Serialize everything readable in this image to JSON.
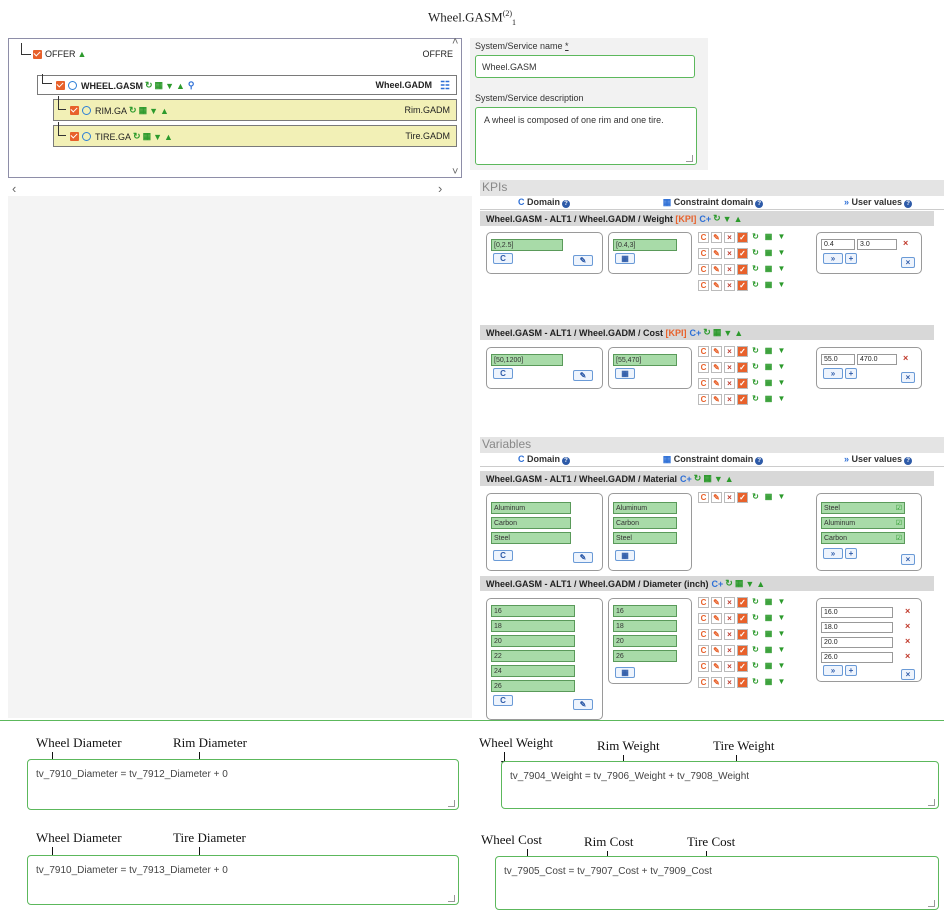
{
  "figure_title": {
    "main": "Wheel.GASM",
    "sup": "(2)",
    "sub": "1"
  },
  "tree": {
    "root": {
      "label": "OFFER",
      "right": "OFFRE"
    },
    "selected": {
      "label": "WHEEL.GASM",
      "right": "Wheel.GADM"
    },
    "children": [
      {
        "label": "RIM.GA",
        "right": "Rim.GADM"
      },
      {
        "label": "TIRE.GA",
        "right": "Tire.GADM"
      }
    ]
  },
  "form": {
    "name_label": "System/Service name",
    "required_mark": "*",
    "name_value": "Wheel.GASM",
    "desc_label": "System/Service description",
    "desc_value": "A wheel is composed of one rim and one tire."
  },
  "columns": {
    "domain": "Domain",
    "constraint": "Constraint domain",
    "user": "User values"
  },
  "kpis": {
    "title": "KPIs",
    "groups": [
      {
        "title": "Wheel.GASM - ALT1 / Wheel.GADM / Weight",
        "tag": "[KPI]",
        "domain": [
          "[0,2.5]"
        ],
        "constraint": [
          "[0.4,3]"
        ],
        "user": [
          {
            "a": "0.4",
            "b": "3.0"
          }
        ]
      },
      {
        "title": "Wheel.GASM - ALT1 / Wheel.GADM / Cost",
        "tag": "[KPI]",
        "domain": [
          "[50,1200]"
        ],
        "constraint": [
          "[55,470]"
        ],
        "user": [
          {
            "a": "55.0",
            "b": "470.0"
          }
        ]
      }
    ]
  },
  "variables": {
    "title": "Variables",
    "groups": [
      {
        "title": "Wheel.GASM - ALT1 / Wheel.GADM / Material",
        "domain": [
          "Aluminum",
          "Carbon",
          "Steel"
        ],
        "constraint": [
          "Aluminum",
          "Carbon",
          "Steel"
        ],
        "user": [
          "Steel",
          "Aluminum",
          "Carbon"
        ]
      },
      {
        "title": "Wheel.GASM - ALT1 / Wheel.GADM / Diameter (inch)",
        "domain": [
          "16",
          "18",
          "20",
          "22",
          "24",
          "26"
        ],
        "constraint": [
          "16",
          "18",
          "20",
          "26"
        ],
        "user": [
          "16.0",
          "18.0",
          "20.0",
          "26.0"
        ]
      }
    ]
  },
  "formulas": [
    {
      "text": "tv_7910_Diameter = tv_7912_Diameter + 0",
      "labels": [
        "Wheel Diameter",
        "Rim Diameter"
      ]
    },
    {
      "text": "tv_7904_Weight =   tv_7906_Weight + tv_7908_Weight",
      "labels": [
        "Wheel Weight",
        "Rim Weight",
        "Tire Weight"
      ]
    },
    {
      "text": "tv_7910_Diameter = tv_7913_Diameter + 0",
      "labels": [
        "Wheel Diameter",
        "Tire Diameter"
      ]
    },
    {
      "text": "tv_7905_Cost = tv_7907_Cost + tv_7909_Cost",
      "labels": [
        "Wheel Cost",
        "Rim Cost",
        "Tire Cost"
      ]
    }
  ],
  "colors": {
    "accent_green": "#5cb85c",
    "checkbox_orange": "#e8612b",
    "tree_highlight": "#f2f0b6"
  }
}
